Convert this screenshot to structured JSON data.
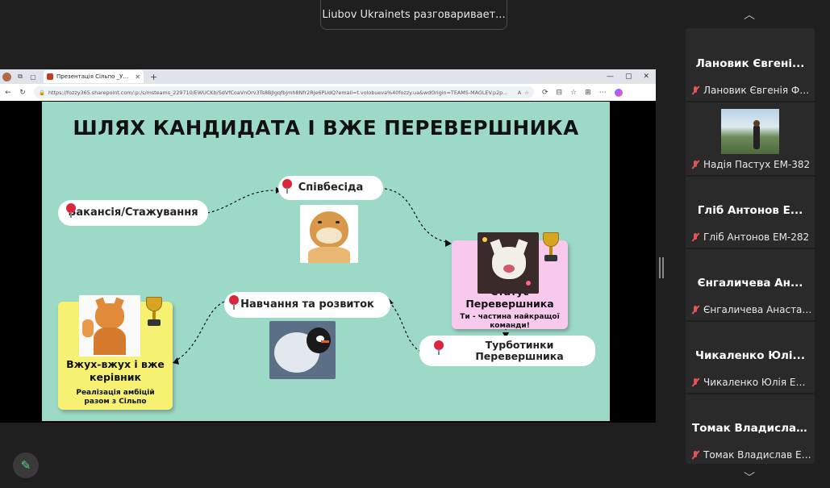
{
  "toast": {
    "text": "Liubov Ukrainets разговаривает..."
  },
  "browser": {
    "tab_title": "Презентація Сільпо _Українець",
    "url": "https://fozzy365.sharepoint.com/:p:/s/msteams_229710/EWUCKb/SdVfCoaVnOrv3Ts8BJlgqfbjmh8Nfr2Rje6PUdQ?email=t.volobueva%40fozzy.ua&wdOrigin=TEAMS-MAGLEV.p2p..."
  },
  "slide": {
    "title": "ШЛЯХ КАНДИДАТА І ВЖЕ ПЕРЕВЕРШНИКА",
    "vacancy": "Вакансія/Стажування",
    "interview": "Співбесіда",
    "status_title": "Статус Перевершника",
    "status_sub": "Ти - частина найкращої команди!",
    "care": "Турботинки Перевершника",
    "learning": "Навчання та розвиток",
    "leader_title": "Вжух-вжух і вже керівник",
    "leader_sub": "Реалізація амбіцій разом з Сільпо"
  },
  "participants": [
    {
      "name": "Лановик Євгені...",
      "label": "Лановик Євгенія ФЕБ..."
    },
    {
      "name": "",
      "label": "Надія Пастух ЕМ-382",
      "has_photo": true
    },
    {
      "name": "Гліб Антонов Е...",
      "label": "Гліб Антонов ЕМ-282"
    },
    {
      "name": "Єнгаличева Ан...",
      "label": "Єнгаличева Анастасія"
    },
    {
      "name": "Чикаленко Юлі...",
      "label": "Чикаленко Юлія ЕМ-..."
    },
    {
      "name": "Томак Владисла...",
      "label": "Томак Владислав ЕМ..."
    }
  ],
  "colors": {
    "slide_bg": "#9dd9c7",
    "status_card": "#f7c9ec",
    "leader_card": "#f6f173",
    "pin": "#d9263a",
    "muted_mic": "#e25555"
  },
  "icons": {
    "scroll_up": "chevron-up-icon",
    "scroll_down": "chevron-down-icon",
    "annotate": "pen-icon"
  }
}
